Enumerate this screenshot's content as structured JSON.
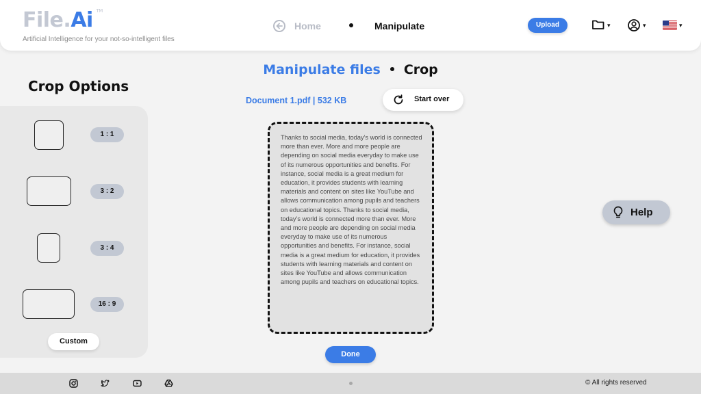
{
  "brand": {
    "name_part1": "File.",
    "name_part2": "Ai",
    "trademark": "TM",
    "tagline": "Artificial Intelligence for your not-so-intelligent files"
  },
  "nav": {
    "back_icon": "back-arrow-circle-icon",
    "home_label": "Home",
    "current_label": "Manipulate"
  },
  "header_actions": {
    "upload_label": "Upload",
    "folder_icon": "folder-icon",
    "account_icon": "user-circle-icon",
    "language_flag": "us-flag-icon",
    "caret": "▾"
  },
  "page": {
    "title_primary": "Manipulate files",
    "title_secondary": "Crop"
  },
  "crop_options": {
    "title": "Crop Options",
    "ratios": [
      {
        "label": "1 : 1"
      },
      {
        "label": "3 : 2"
      },
      {
        "label": "3 : 4"
      },
      {
        "label": "16 : 9"
      }
    ],
    "custom_label": "Custom"
  },
  "document": {
    "info": "Document 1.pdf | 532 KB",
    "start_over_label": "Start over",
    "text": "Thanks to social media, today’s world is connected more than ever. More and more people are depending on social media everyday to make use of its numerous opportunities and benefits. For instance, social media is a great medium for education, it provides students with learning materials and content on sites like YouTube and allows communication among pupils and teachers on educational topics. Thanks to social media, today’s world is connected more than ever. More and more people are depending on social media everyday to make use of its numerous opportunities and benefits. For instance, social media is a great medium for education, it provides students with learning materials and content on sites like YouTube and allows communication among pupils and teachers on educational topics.",
    "done_label": "Done"
  },
  "help": {
    "label": "Help",
    "icon": "lightbulb-icon"
  },
  "footer": {
    "social_icons": [
      "instagram-icon",
      "twitter-icon",
      "youtube-icon",
      "google-drive-icon"
    ],
    "copyright": "© All rights reserved"
  },
  "colors": {
    "accent": "#3b7ce6",
    "muted": "#c2c8d3",
    "panel": "#e8e8e8"
  }
}
